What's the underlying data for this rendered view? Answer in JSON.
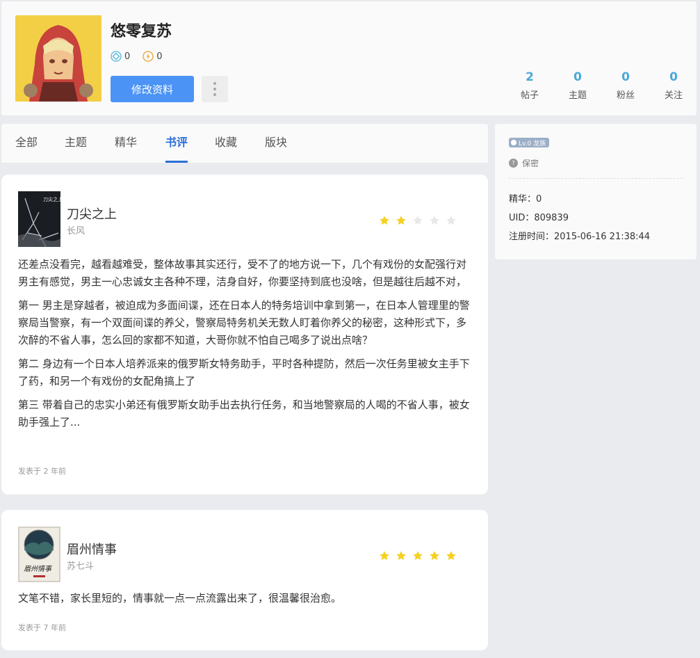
{
  "profile": {
    "username": "悠零复苏",
    "diamond_count": "0",
    "coin_count": "0",
    "edit_label": "修改资料",
    "stats": [
      {
        "num": "2",
        "label": "帖子"
      },
      {
        "num": "0",
        "label": "主题"
      },
      {
        "num": "0",
        "label": "粉丝"
      },
      {
        "num": "0",
        "label": "关注"
      }
    ]
  },
  "tabs": [
    {
      "label": "全部",
      "active": false
    },
    {
      "label": "主题",
      "active": false
    },
    {
      "label": "精华",
      "active": false
    },
    {
      "label": "书评",
      "active": true
    },
    {
      "label": "收藏",
      "active": false
    },
    {
      "label": "版块",
      "active": false
    }
  ],
  "side": {
    "level": "Lv.0 龙族",
    "gender": "保密",
    "elite": "精华：0",
    "uid": "UID：809839",
    "registered": "注册时间：2015-06-16 21:38:44"
  },
  "reviews": [
    {
      "title": "刀尖之上",
      "author": "长风",
      "rating": 2,
      "max_rating": 5,
      "paragraphs": [
        "还差点没看完，越看越难受，整体故事其实还行，受不了的地方说一下，几个有戏份的女配强行对男主有感觉，男主一心忠诚女主各种不理，洁身自好，你要坚持到底也没啥，但是越往后越不对，",
        "第一 男主是穿越者，被迫成为多面间谍，还在日本人的特务培训中拿到第一，在日本人管理里的警察局当警察，有一个双面间谍的养父，警察局特务机关无数人盯着你养父的秘密，这种形式下，多次醉的不省人事，怎么回的家都不知道，大哥你就不怕自己喝多了说出点啥？",
        "第二 身边有一个日本人培养派来的俄罗斯女特务助手，平时各种提防，然后一次任务里被女主手下了药，和另一个有戏份的女配角搞上了",
        "第三 带着自己的忠实小弟还有俄罗斯女助手出去执行任务，和当地警察局的人喝的不省人事，被女助手强上了..."
      ],
      "posted": "发表于 2 年前",
      "cover_text": "刀尖之上"
    },
    {
      "title": "眉州情事",
      "author": "苏七斗",
      "rating": 5,
      "max_rating": 5,
      "paragraphs": [
        "文笔不错，家长里短的，情事就一点一点流露出来了，很温馨很治愈。"
      ],
      "posted": "发表于 7 年前",
      "cover_text": "眉州情事"
    }
  ],
  "colors": {
    "accent": "#4b93f5",
    "tab_active": "#2b6fd6",
    "stat_num": "#4aa8d8",
    "star_on": "#f5d020",
    "star_off": "#e8e8e8"
  }
}
